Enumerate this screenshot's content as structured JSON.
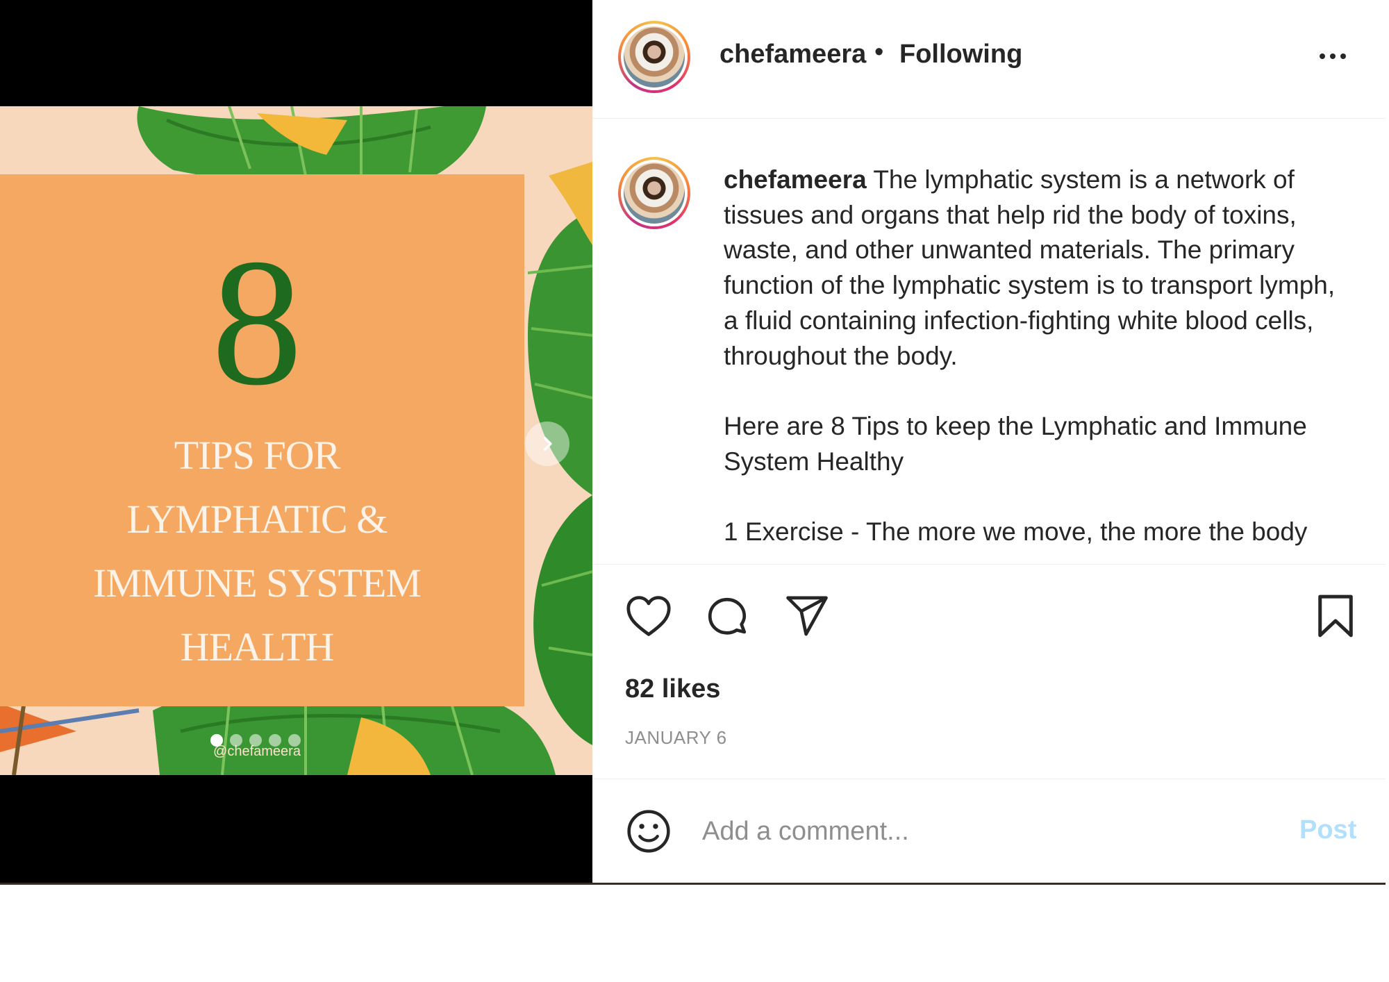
{
  "post": {
    "username": "chefameera",
    "separator": "•",
    "follow_status": "Following",
    "more_icon": "more-horizontal-icon"
  },
  "media": {
    "slide_count": 5,
    "active_slide": 1,
    "image": {
      "number": "8",
      "lines": [
        "TIPS FOR",
        "LYMPHATIC &",
        "IMMUNE SYSTEM",
        "HEALTH"
      ],
      "handle": "@chefameera"
    },
    "next_icon": "chevron-right-icon"
  },
  "caption": {
    "username": "chefameera",
    "intro": "The lymphatic system is a network of tissues and organs that help rid the body of toxins, waste, and other unwanted materials. The primary function of the lymphatic system is to transport lymph, a fluid containing infection-fighting white blood cells, throughout the body.",
    "tips_heading": "Here are 8 Tips to keep the Lymphatic and Immune System Healthy",
    "tip_1": "1 Exercise - The more we move, the more the body"
  },
  "actions": {
    "like_icon": "heart-icon",
    "comment_icon": "comment-icon",
    "share_icon": "share-icon",
    "save_icon": "bookmark-icon",
    "likes": "82 likes",
    "date": "JANUARY 6"
  },
  "comment": {
    "emoji_icon": "emoji-icon",
    "placeholder": "Add a comment...",
    "post_label": "Post"
  },
  "colors": {
    "card_background": "#f4a862",
    "number_green": "#1e6a1f",
    "post_button_disabled": "#b2dffc",
    "text_primary": "#262626",
    "text_secondary": "#8e8e8e"
  }
}
